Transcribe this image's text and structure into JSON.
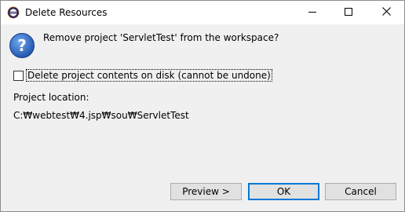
{
  "window": {
    "title": "Delete Resources",
    "controls": {
      "minimize": "minimize",
      "maximize": "maximize",
      "close": "close"
    }
  },
  "dialog": {
    "message": "Remove project 'ServletTest' from the workspace?",
    "checkbox": {
      "label": "Delete project contents on disk (cannot be undone)",
      "checked": false
    },
    "location_label": "Project location:",
    "location_value": "C:₩webtest₩4.jsp₩sou₩ServletTest"
  },
  "buttons": {
    "preview": "Preview >",
    "ok": "OK",
    "cancel": "Cancel"
  },
  "icons": {
    "app": "eclipse-icon",
    "question": "question-icon"
  },
  "colors": {
    "accent": "#0078d7",
    "dialog_bg": "#f0f0f0",
    "button_bg": "#e1e1e1"
  }
}
